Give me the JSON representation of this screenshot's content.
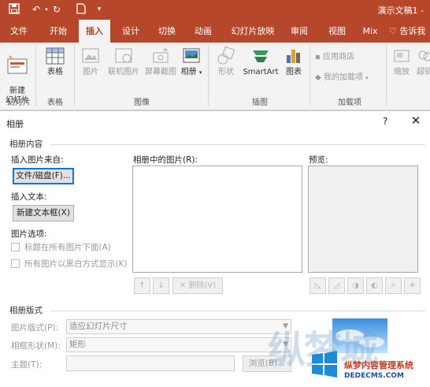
{
  "app": {
    "doc_title": "演示文稿1 -",
    "quick_access": [
      "save-icon",
      "undo-icon",
      "redo-icon",
      "new-file-icon",
      "customize-icon"
    ]
  },
  "tabs": [
    {
      "label": "文件"
    },
    {
      "label": "开始"
    },
    {
      "label": "插入",
      "active": true
    },
    {
      "label": "设计"
    },
    {
      "label": "切换"
    },
    {
      "label": "动画"
    },
    {
      "label": "幻灯片放映"
    },
    {
      "label": "审阅"
    },
    {
      "label": "视图"
    },
    {
      "label": "Mix"
    },
    {
      "label": "告诉我"
    }
  ],
  "ribbon": {
    "new_slide": "新建\n幻灯片",
    "table": "表格",
    "picture": "图片",
    "online_picture": "联机图片",
    "screenshot": "屏幕截图",
    "album": "相册",
    "shapes": "形状",
    "smartart": "SmartArt",
    "chart": "图表",
    "store": "应用商店",
    "my_addins": "我的加载项",
    "zoom": "缩放",
    "link": "超链",
    "groups": [
      "幻灯片",
      "表格",
      "图像",
      "插图",
      "加载项"
    ]
  },
  "dialog": {
    "title": "相册",
    "help": "?",
    "close": "✕",
    "album_content": "相册内容",
    "insert_from": "插入图片来自:",
    "file_disk_btn": "文件/磁盘(F)...",
    "insert_text": "插入文本:",
    "new_textbox_btn": "新建文本框(X)",
    "picture_options": "图片选项:",
    "caption_below": "标题在所有图片下面(A)",
    "all_bw": "所有图片以黑白方式显示(K)",
    "pictures_in_album": "相册中的图片(R):",
    "preview": "预览:",
    "up_arrow": "↑",
    "down_arrow": "↓",
    "delete_btn": "删除(V)",
    "album_layout": "相册版式",
    "picture_layout_label": "图片版式(P):",
    "picture_layout_value": "适应幻灯片尺寸",
    "frame_shape_label": "相框形状(M):",
    "frame_shape_value": "矩形",
    "theme_label": "主题(T):",
    "theme_value": "",
    "browse_btn": "浏览(B)..."
  },
  "watermark": {
    "line1": "纵梦内容管理系统",
    "line2": "DEDECMS.COM"
  }
}
